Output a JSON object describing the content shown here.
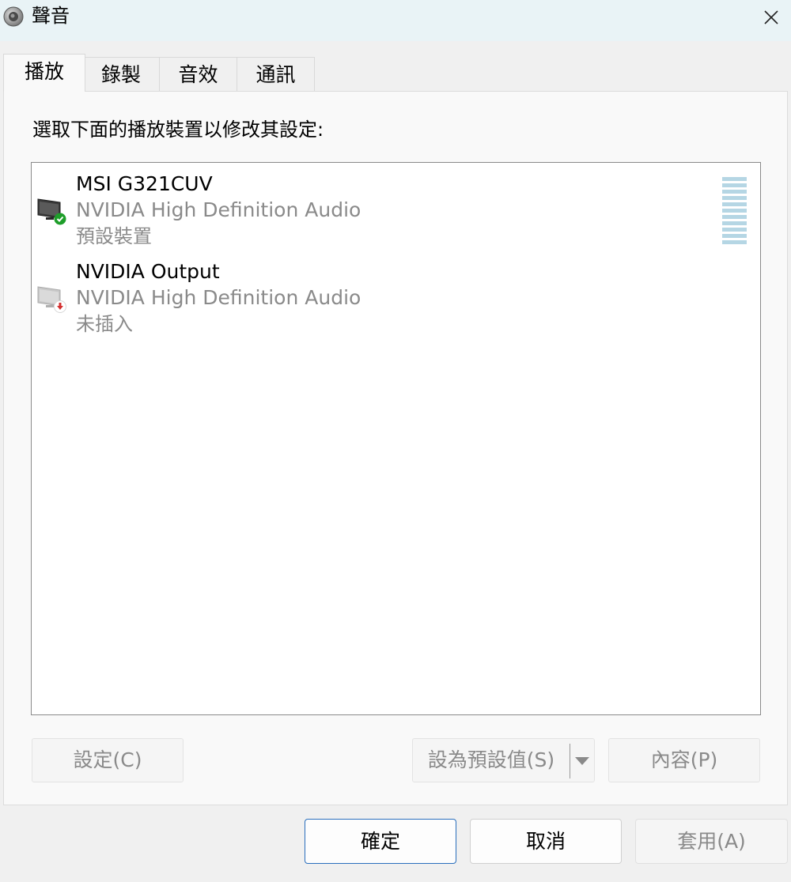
{
  "window": {
    "title": "聲音",
    "icon": "speaker-icon",
    "close_icon": "close-icon"
  },
  "tabs": [
    {
      "label": "播放",
      "active": true
    },
    {
      "label": "錄製",
      "active": false
    },
    {
      "label": "音效",
      "active": false
    },
    {
      "label": "通訊",
      "active": false
    }
  ],
  "playback": {
    "instruction": "選取下面的播放裝置以修改其設定:",
    "devices": [
      {
        "name": "MSI G321CUV",
        "driver": "NVIDIA High Definition Audio",
        "status": "預設裝置",
        "icon": "monitor-speaker-icon",
        "badge": "default-check-icon",
        "badge_color": "#1e9e2a"
      },
      {
        "name": "NVIDIA Output",
        "driver": "NVIDIA High Definition Audio",
        "status": "未插入",
        "icon": "monitor-speaker-icon",
        "badge": "unplugged-arrow-icon",
        "badge_color": "#d32f2f"
      }
    ],
    "buttons": {
      "configure": "設定(C)",
      "set_default": "設為預設值(S)",
      "properties": "內容(P)"
    }
  },
  "footer": {
    "ok": "確定",
    "cancel": "取消",
    "apply": "套用(A)"
  },
  "colors": {
    "titlebar": "#e9f3f6",
    "meter": "#b5d6e4",
    "ok_border": "#2a6fbd"
  }
}
